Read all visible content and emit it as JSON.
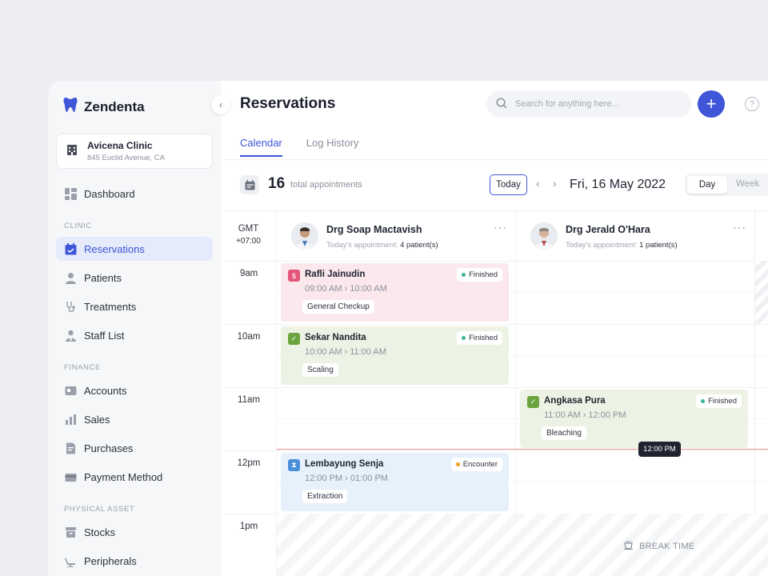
{
  "brand": {
    "name": "Zendenta"
  },
  "clinic": {
    "name": "Avicena Clinic",
    "address": "845 Euclid Avenue, CA"
  },
  "sidebar": {
    "dashboard": "Dashboard",
    "sections": {
      "clinic": "CLINIC",
      "finance": "FINANCE",
      "asset": "PHYSICAL ASSET"
    },
    "items": {
      "reservations": "Reservations",
      "patients": "Patients",
      "treatments": "Treatments",
      "staff": "Staff List",
      "accounts": "Accounts",
      "sales": "Sales",
      "purchases": "Purchases",
      "payment": "Payment Method",
      "stocks": "Stocks",
      "peripherals": "Peripherals"
    }
  },
  "header": {
    "title": "Reservations",
    "search_placeholder": "Search for anything here...",
    "add_label": "+",
    "help_label": "?"
  },
  "tabs": {
    "calendar": "Calendar",
    "log": "Log History"
  },
  "toolbar": {
    "count": "16",
    "count_label": "total appointments",
    "today": "Today",
    "prev": "‹",
    "next": "›",
    "date": "Fri, 16 May 2022",
    "view_day": "Day",
    "view_week": "Week"
  },
  "grid": {
    "gmt": "GMT",
    "offset": "+07:00",
    "hours": [
      "9am",
      "10am",
      "11am",
      "12pm",
      "1pm"
    ],
    "now_label": "12:00 PM",
    "break_label": "BREAK TIME"
  },
  "doctors": [
    {
      "name": "Drg Soap Mactavish",
      "sub": "Today's appointment:",
      "count": "4 patient(s)",
      "more": "···"
    },
    {
      "name": "Drg Jerald O'Hara",
      "sub": "Today's appointment:",
      "count": "1 patient(s)",
      "more": "···"
    }
  ],
  "appointments": [
    {
      "name": "Rafli Jainudin",
      "time": "09:00 AM › 10:00 AM",
      "tag": "General Checkup",
      "status": "Finished",
      "color": "#e4557a"
    },
    {
      "name": "Sekar Nandita",
      "time": "10:00 AM › 11:00 AM",
      "tag": "Scaling",
      "status": "Finished",
      "color": "#6aa33f"
    },
    {
      "name": "Angkasa Pura",
      "time": "11:00 AM › 12:00 PM",
      "tag": "Bleaching",
      "status": "Finished",
      "color": "#6aa33f"
    },
    {
      "name": "Lembayung Senja",
      "time": "12:00 PM › 01:00 PM",
      "tag": "Extraction",
      "status": "Encounter",
      "color": "#4a90d9"
    }
  ],
  "colors": {
    "accent": "#3f56d9",
    "finished": "#3fb29a",
    "encounter": "#f0a020"
  }
}
